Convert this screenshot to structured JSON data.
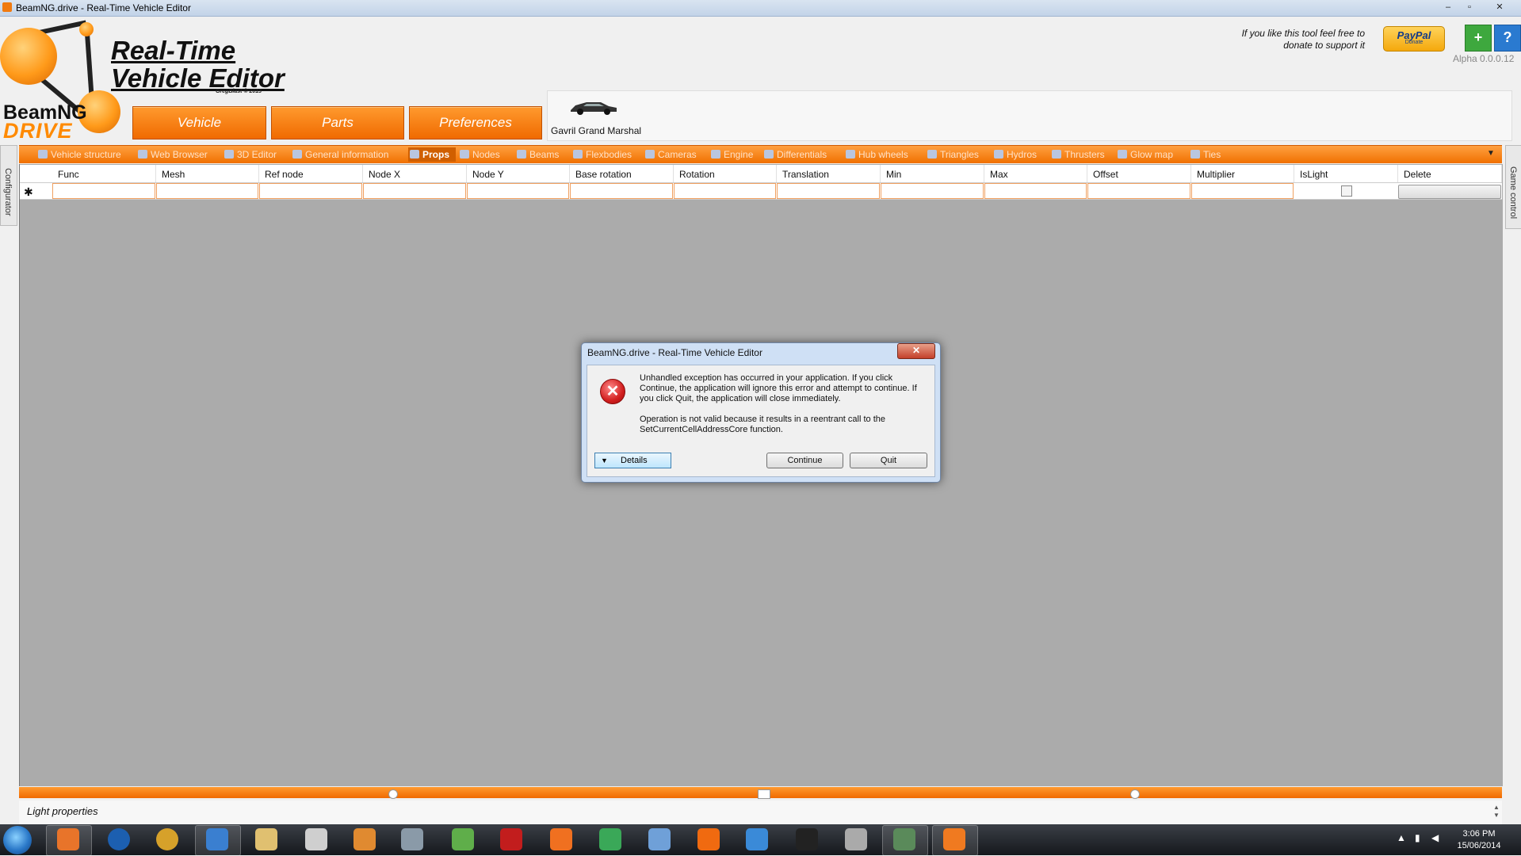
{
  "window": {
    "title": "BeamNG.drive - Real-Time Vehicle Editor",
    "min": "–",
    "max": "▫",
    "close": "✕"
  },
  "header": {
    "brand_line1": "BeamNG",
    "brand_line2": "DRIVE",
    "app_title_line1": "Real-Time",
    "app_title_line2": "Vehicle Editor",
    "author": "GregBlast © 2013",
    "nav": [
      "Vehicle",
      "Parts",
      "Preferences"
    ],
    "vehicle_name": "Gavril Grand Marshal",
    "donate_text": "If you like this tool feel free to donate to support it",
    "paypal_label": "PayPal",
    "paypal_sub": "Donate",
    "plus": "+",
    "help": "?",
    "version": "Alpha 0.0.0.12"
  },
  "tabs": [
    {
      "label": "Vehicle structure",
      "icon": "tree-icon"
    },
    {
      "label": "Web Browser",
      "icon": "globe-icon"
    },
    {
      "label": "3D Editor",
      "icon": "cube-icon"
    },
    {
      "label": "General information",
      "icon": "grid-icon"
    },
    {
      "label": "Props",
      "icon": "grid-icon",
      "active": true
    },
    {
      "label": "Nodes",
      "icon": "dot-icon"
    },
    {
      "label": "Beams",
      "icon": "beam-icon"
    },
    {
      "label": "Flexbodies",
      "icon": "grid-icon"
    },
    {
      "label": "Cameras",
      "icon": "grid-icon"
    },
    {
      "label": "Engine",
      "icon": "grid-icon"
    },
    {
      "label": "Differentials",
      "icon": "grid-icon"
    },
    {
      "label": "Hub wheels",
      "icon": "grid-icon"
    },
    {
      "label": "Triangles",
      "icon": "triangle-icon"
    },
    {
      "label": "Hydros",
      "icon": "grid-icon"
    },
    {
      "label": "Thrusters",
      "icon": "grid-icon"
    },
    {
      "label": "Glow map",
      "icon": "grid-icon"
    },
    {
      "label": "Ties",
      "icon": "grid-icon"
    }
  ],
  "side": {
    "left": "Configurator",
    "right": "Game control"
  },
  "grid": {
    "columns": [
      "Func",
      "Mesh",
      "Ref node",
      "Node X",
      "Node Y",
      "Base rotation",
      "Rotation",
      "Translation",
      "Min",
      "Max",
      "Offset",
      "Multiplier",
      "IsLight",
      "Delete"
    ],
    "new_row_marker": "✱"
  },
  "bottom": {
    "light_properties": "Light properties"
  },
  "dialog": {
    "title": "BeamNG.drive - Real-Time Vehicle Editor",
    "close": "✕",
    "message": "Unhandled exception has occurred in your application. If you click Continue, the application will ignore this error and attempt to continue. If you click Quit, the application will close immediately.",
    "detail": "Operation is not valid because it results in a reentrant call to the SetCurrentCellAddressCore function.",
    "details_button": "Details",
    "continue_button": "Continue",
    "quit_button": "Quit",
    "error_glyph": "✕"
  },
  "taskbar": {
    "time": "3:06 PM",
    "date": "15/06/2014",
    "apps": [
      "firefox-icon",
      "globe-icon",
      "chrome-icon",
      "thunderbird-icon",
      "explorer-icon",
      "clock-icon",
      "media-icon",
      "steam-icon",
      "notepad-icon",
      "filezilla-icon",
      "x-icon",
      "64-icon",
      "network-icon",
      "dots-icon",
      "vs-icon",
      "rp-icon",
      "gamepad-icon",
      "screen-icon",
      "beamng-editor-icon"
    ],
    "colors": {
      "orange": "#f07000",
      "taskbar": "#1d2126"
    }
  }
}
